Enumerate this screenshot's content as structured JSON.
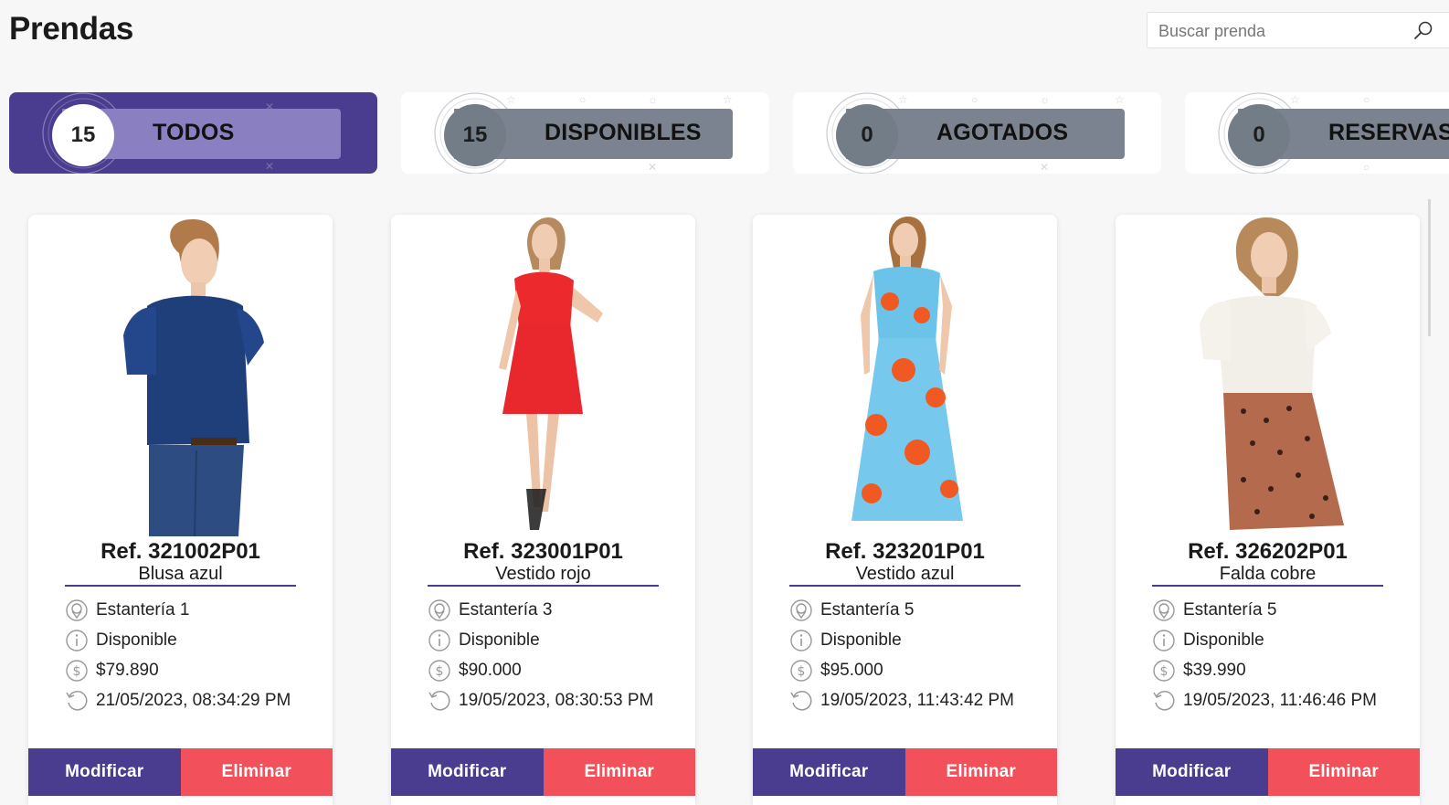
{
  "page": {
    "title": "Prendas"
  },
  "search": {
    "placeholder": "Buscar prenda",
    "value": ""
  },
  "filters": [
    {
      "count": "15",
      "label": "TODOS",
      "active": true
    },
    {
      "count": "15",
      "label": "DISPONIBLES",
      "active": false
    },
    {
      "count": "0",
      "label": "AGOTADOS",
      "active": false
    },
    {
      "count": "0",
      "label": "RESERVAS",
      "active": false
    }
  ],
  "products": [
    {
      "ref": "Ref. 321002P01",
      "name": "Blusa azul",
      "location": "Estantería 1",
      "status": "Disponible",
      "price": "$79.890",
      "date": "21/05/2023, 08:34:29 PM"
    },
    {
      "ref": "Ref. 323001P01",
      "name": "Vestido rojo",
      "location": "Estantería 3",
      "status": "Disponible",
      "price": "$90.000",
      "date": "19/05/2023, 08:30:53 PM"
    },
    {
      "ref": "Ref. 323201P01",
      "name": "Vestido azul",
      "location": "Estantería 5",
      "status": "Disponible",
      "price": "$95.000",
      "date": "19/05/2023, 11:43:42 PM"
    },
    {
      "ref": "Ref. 326202P01",
      "name": "Falda cobre",
      "location": "Estantería 5",
      "status": "Disponible",
      "price": "$39.990",
      "date": "19/05/2023, 11:46:46 PM"
    }
  ],
  "actions": {
    "edit_label": "Modificar",
    "delete_label": "Eliminar"
  },
  "colors": {
    "primary": "#4a3d8f",
    "danger": "#f2505a",
    "pill_active": "#8a7fc0",
    "pill_inactive": "#7a838f"
  },
  "icons": {
    "search": "search-icon",
    "location": "location-pin-icon",
    "status": "info-icon",
    "price": "dollar-icon",
    "date": "history-icon"
  }
}
